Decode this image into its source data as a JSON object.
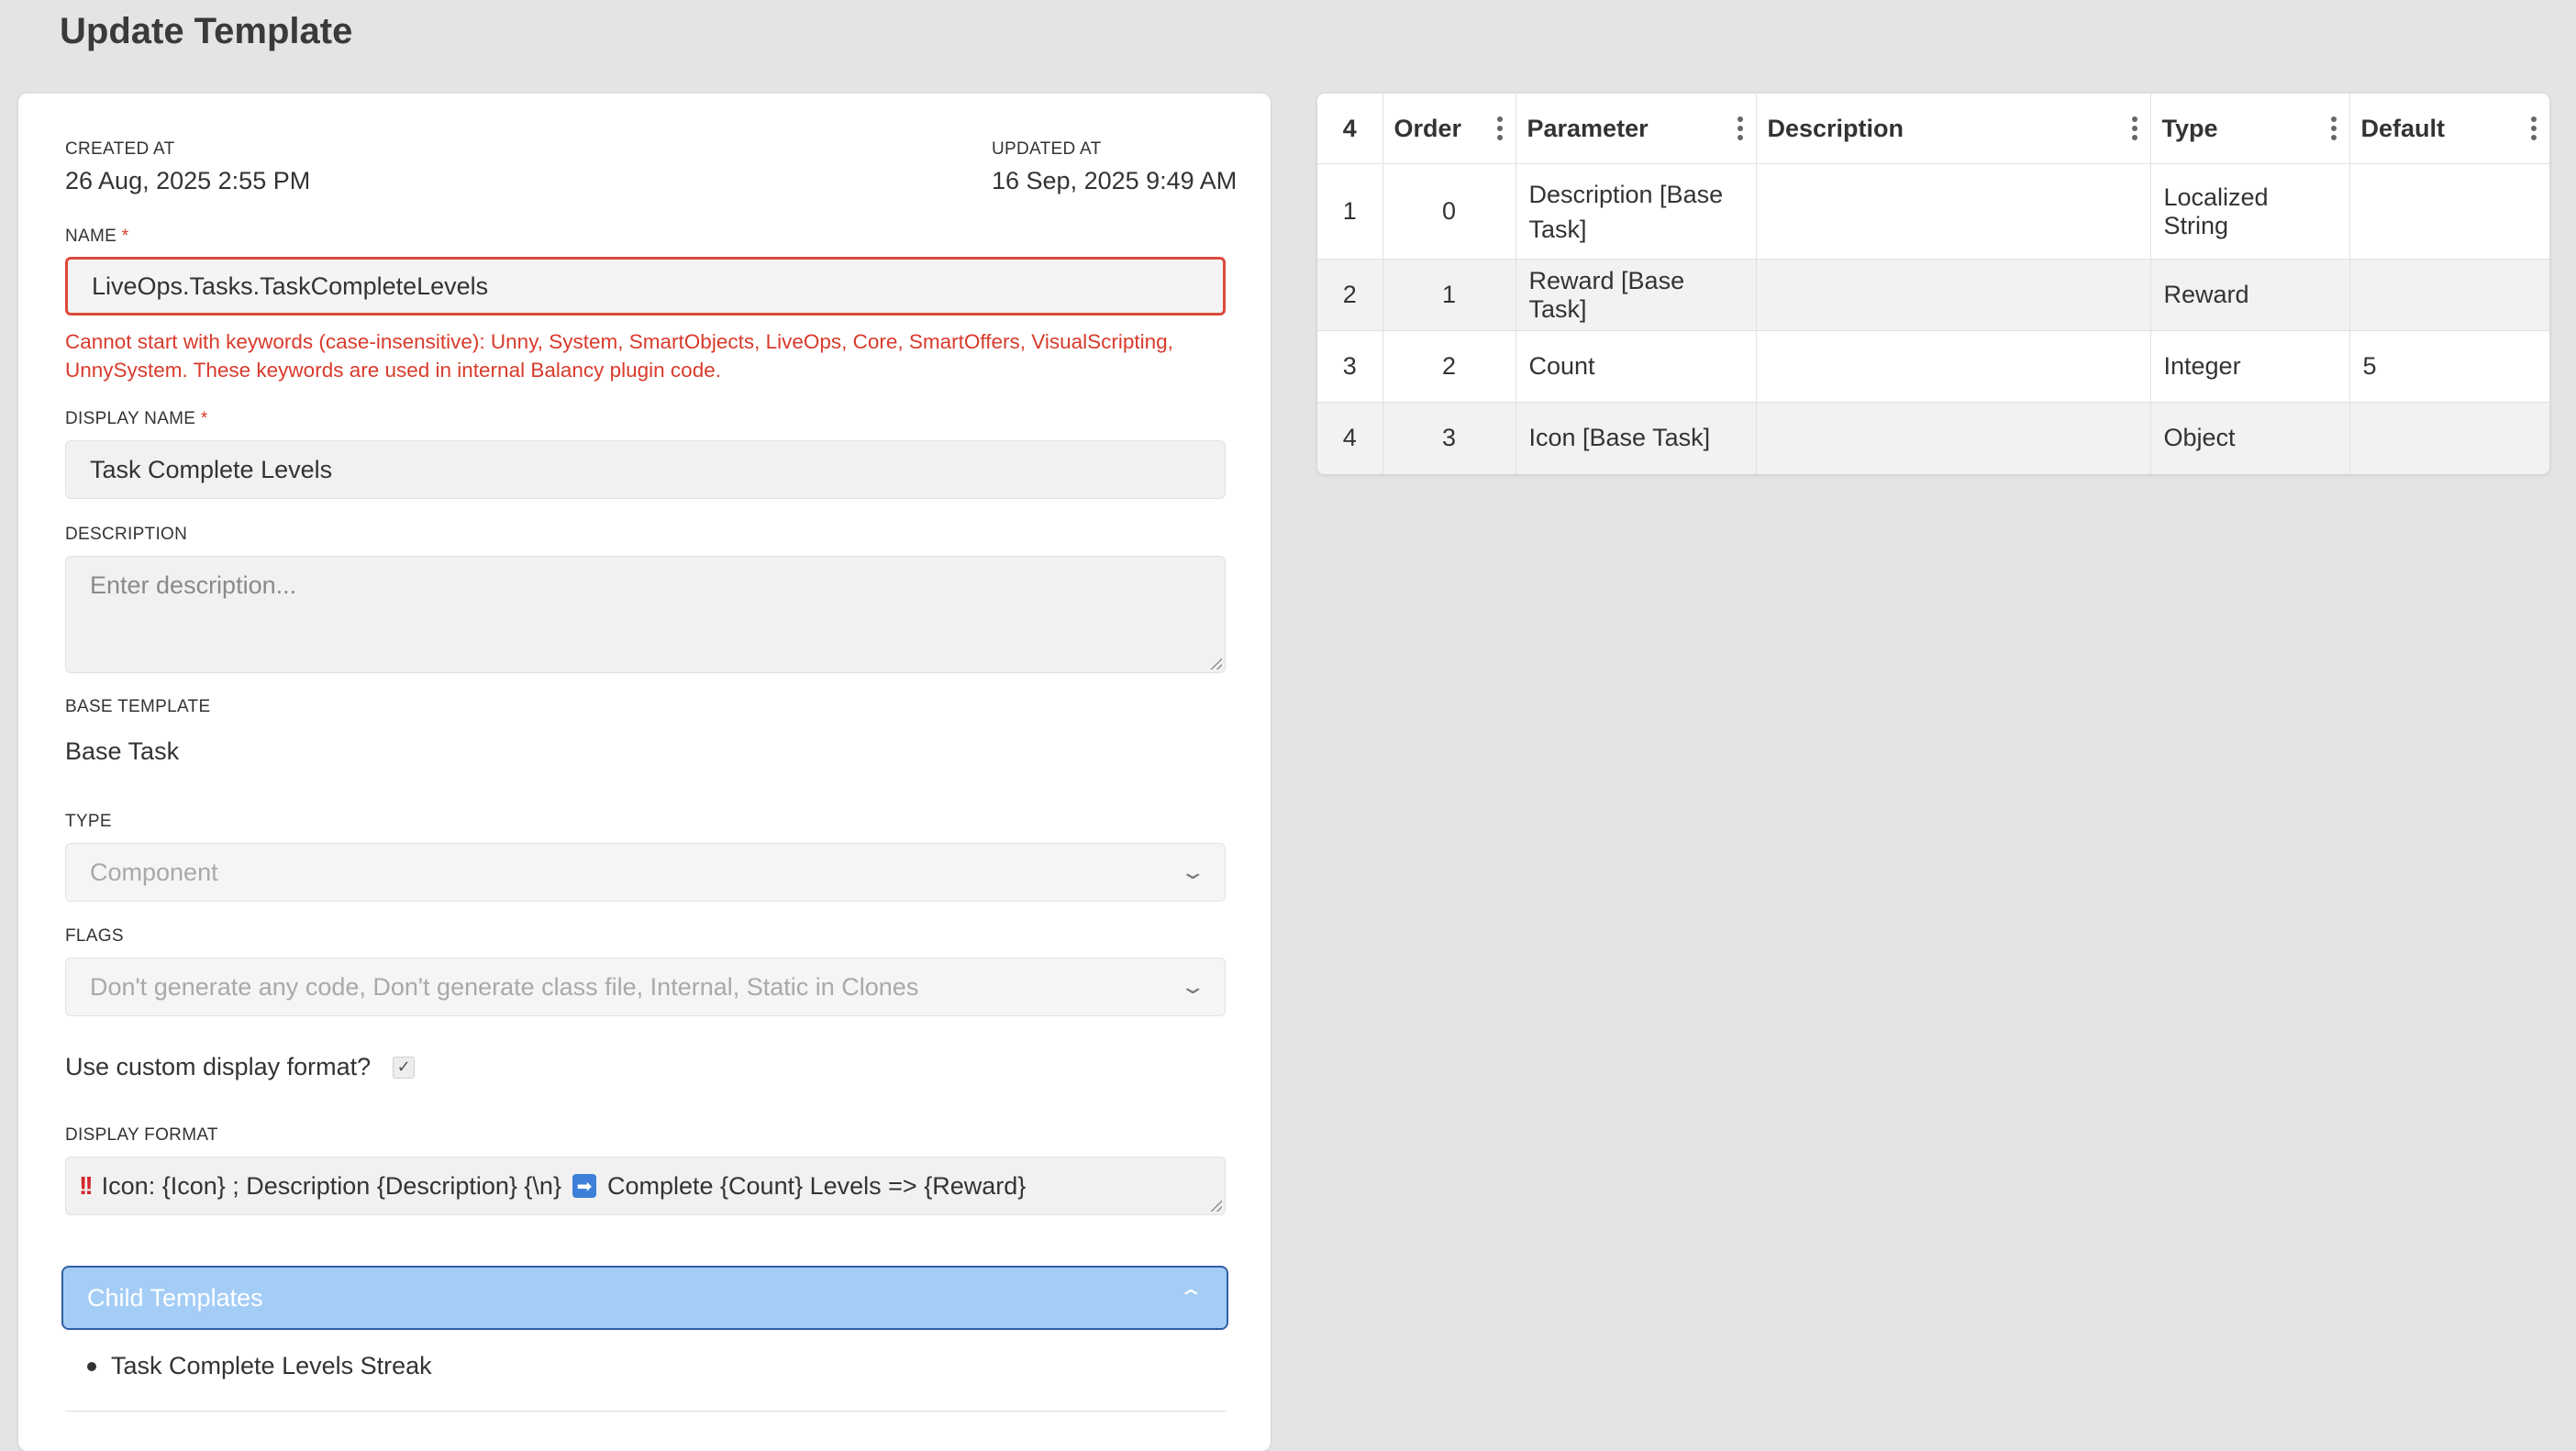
{
  "page": {
    "title": "Update Template"
  },
  "meta": {
    "created_label": "CREATED AT",
    "created_value": "26 Aug, 2025 2:55 PM",
    "updated_label": "UPDATED AT",
    "updated_value": "16 Sep, 2025 9:49 AM"
  },
  "form": {
    "name": {
      "label": "NAME",
      "required_mark": "*",
      "value": "LiveOps.Tasks.TaskCompleteLevels",
      "error": "Cannot start with keywords (case-insensitive): Unny, System, SmartObjects, LiveOps, Core, SmartOffers, VisualScripting, UnnySystem. These keywords are used in internal Balancy plugin code."
    },
    "display_name": {
      "label": "DISPLAY NAME",
      "required_mark": "*",
      "value": "Task Complete Levels"
    },
    "description": {
      "label": "DESCRIPTION",
      "placeholder": "Enter description..."
    },
    "base_template": {
      "label": "BASE TEMPLATE",
      "value": "Base Task"
    },
    "type": {
      "label": "TYPE",
      "value": "Component"
    },
    "flags": {
      "label": "FLAGS",
      "value": "Don't generate any code, Don't generate class file, Internal, Static in Clones"
    },
    "custom_format": {
      "label": "Use custom display format?",
      "checked": true,
      "check_glyph": "✓"
    },
    "display_format": {
      "label": "DISPLAY FORMAT",
      "warn_glyph": "!!",
      "part1": "Icon: {Icon} ; Description {Description} {\\n}",
      "arrow_glyph": "➡",
      "part2": "Complete {Count} Levels => {Reward}"
    }
  },
  "child_templates": {
    "label": "Child Templates",
    "items": [
      "Task Complete Levels Streak"
    ]
  },
  "table": {
    "row_count_header": "4",
    "columns": [
      "Order",
      "Parameter",
      "Description",
      "Type",
      "Default"
    ],
    "rows": [
      {
        "index": "1",
        "order": "0",
        "parameter": "Description [Base Task]",
        "description": "",
        "type": "Localized String",
        "default": ""
      },
      {
        "index": "2",
        "order": "1",
        "parameter": "Reward [Base Task]",
        "description": "",
        "type": "Reward",
        "default": ""
      },
      {
        "index": "3",
        "order": "2",
        "parameter": "Count",
        "description": "",
        "type": "Integer",
        "default": "5"
      },
      {
        "index": "4",
        "order": "3",
        "parameter": "Icon [Base Task]",
        "description": "",
        "type": "Object",
        "default": ""
      }
    ]
  },
  "icons": {
    "column_menu": "vertical-dots-icon",
    "select_chevron": "chevron-down-icon",
    "collapse_chevron": "chevron-up-icon"
  },
  "colors": {
    "error": "#d93a2b",
    "accent_bar": "#a4cdf6",
    "accent_border": "#2f5fa3"
  }
}
